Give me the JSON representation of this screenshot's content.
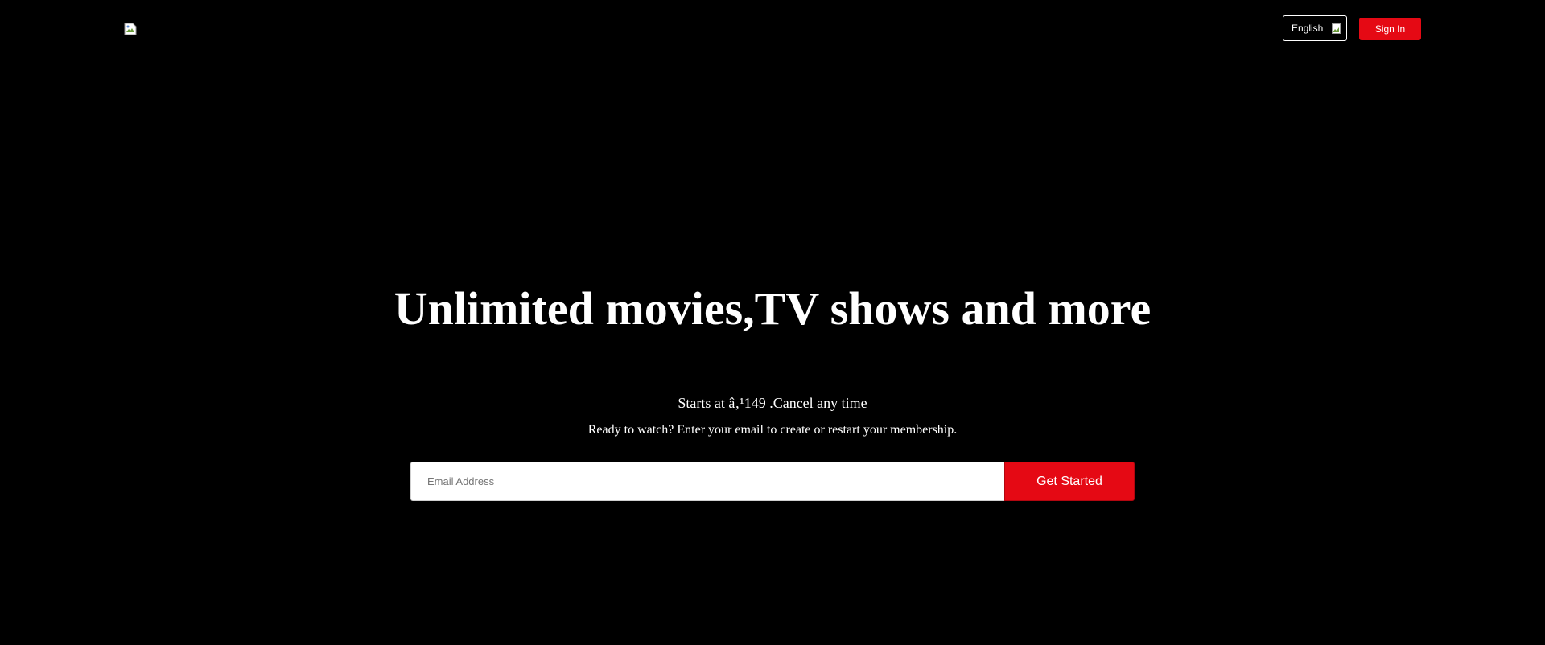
{
  "header": {
    "logo_icon": "broken-image-icon",
    "language": {
      "selected": "English",
      "icon": "broken-image-icon"
    },
    "signin_label": "Sign In"
  },
  "hero": {
    "title": "Unlimited movies,TV shows and more",
    "subtitle": "Starts at â‚¹149 .Cancel any time",
    "prompt": "Ready to watch? Enter your email to create or restart your membership.",
    "email_placeholder": "Email Address",
    "email_value": "",
    "cta_label": "Get Started"
  },
  "colors": {
    "background": "#000000",
    "accent": "#e50914",
    "text": "#ffffff"
  }
}
